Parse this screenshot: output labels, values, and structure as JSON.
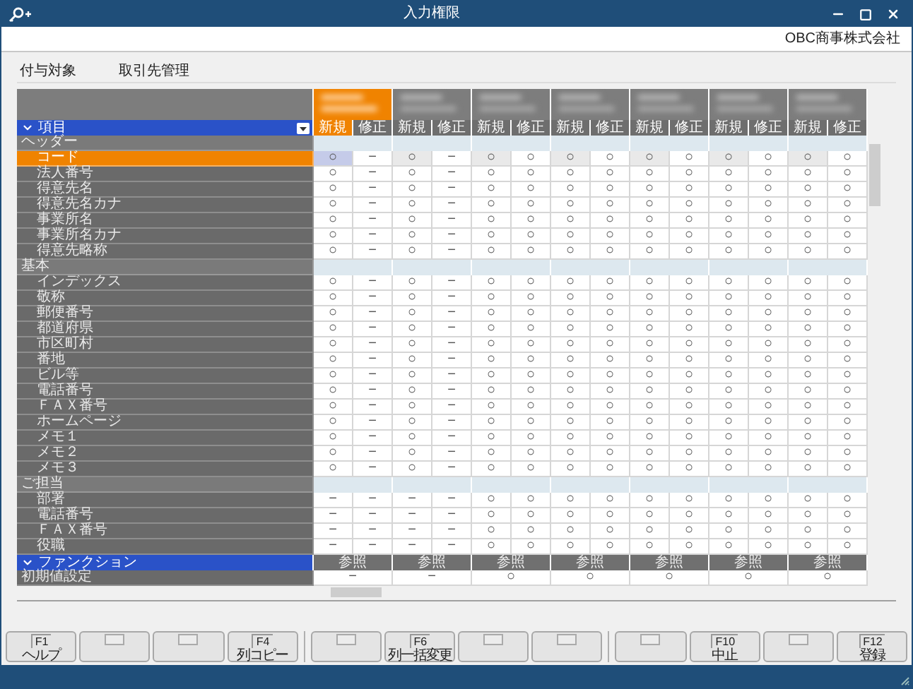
{
  "window": {
    "title": "入力権限"
  },
  "company": "OBC商事株式会社",
  "target": {
    "label": "付与対象",
    "value": "取引先管理"
  },
  "columns": [
    {
      "selected": true,
      "subheaders": [
        "新規",
        "修正"
      ]
    },
    {
      "selected": false,
      "subheaders": [
        "新規",
        "修正"
      ]
    },
    {
      "selected": false,
      "subheaders": [
        "新規",
        "修正"
      ]
    },
    {
      "selected": false,
      "subheaders": [
        "新規",
        "修正"
      ]
    },
    {
      "selected": false,
      "subheaders": [
        "新規",
        "修正"
      ]
    },
    {
      "selected": false,
      "subheaders": [
        "新規",
        "修正"
      ]
    },
    {
      "selected": false,
      "subheaders": [
        "新規",
        "修正"
      ]
    }
  ],
  "items_header": "項目",
  "sections": [
    {
      "label": "ヘッダー",
      "items": [
        {
          "label": "コード",
          "selected": true,
          "values": [
            "○",
            "−",
            "○",
            "−",
            "○",
            "○",
            "○",
            "○",
            "○",
            "○",
            "○",
            "○",
            "○",
            "○"
          ]
        },
        {
          "label": "法人番号",
          "selected": false,
          "values": [
            "○",
            "−",
            "○",
            "−",
            "○",
            "○",
            "○",
            "○",
            "○",
            "○",
            "○",
            "○",
            "○",
            "○"
          ]
        },
        {
          "label": "得意先名",
          "selected": false,
          "values": [
            "○",
            "−",
            "○",
            "−",
            "○",
            "○",
            "○",
            "○",
            "○",
            "○",
            "○",
            "○",
            "○",
            "○"
          ]
        },
        {
          "label": "得意先名カナ",
          "selected": false,
          "values": [
            "○",
            "−",
            "○",
            "−",
            "○",
            "○",
            "○",
            "○",
            "○",
            "○",
            "○",
            "○",
            "○",
            "○"
          ]
        },
        {
          "label": "事業所名",
          "selected": false,
          "values": [
            "○",
            "−",
            "○",
            "−",
            "○",
            "○",
            "○",
            "○",
            "○",
            "○",
            "○",
            "○",
            "○",
            "○"
          ]
        },
        {
          "label": "事業所名カナ",
          "selected": false,
          "values": [
            "○",
            "−",
            "○",
            "−",
            "○",
            "○",
            "○",
            "○",
            "○",
            "○",
            "○",
            "○",
            "○",
            "○"
          ]
        },
        {
          "label": "得意先略称",
          "selected": false,
          "values": [
            "○",
            "−",
            "○",
            "−",
            "○",
            "○",
            "○",
            "○",
            "○",
            "○",
            "○",
            "○",
            "○",
            "○"
          ]
        }
      ]
    },
    {
      "label": "基本",
      "items": [
        {
          "label": "インデックス",
          "selected": false,
          "values": [
            "○",
            "−",
            "○",
            "−",
            "○",
            "○",
            "○",
            "○",
            "○",
            "○",
            "○",
            "○",
            "○",
            "○"
          ]
        },
        {
          "label": "敬称",
          "selected": false,
          "values": [
            "○",
            "−",
            "○",
            "−",
            "○",
            "○",
            "○",
            "○",
            "○",
            "○",
            "○",
            "○",
            "○",
            "○"
          ]
        },
        {
          "label": "郵便番号",
          "selected": false,
          "values": [
            "○",
            "−",
            "○",
            "−",
            "○",
            "○",
            "○",
            "○",
            "○",
            "○",
            "○",
            "○",
            "○",
            "○"
          ]
        },
        {
          "label": "都道府県",
          "selected": false,
          "values": [
            "○",
            "−",
            "○",
            "−",
            "○",
            "○",
            "○",
            "○",
            "○",
            "○",
            "○",
            "○",
            "○",
            "○"
          ]
        },
        {
          "label": "市区町村",
          "selected": false,
          "values": [
            "○",
            "−",
            "○",
            "−",
            "○",
            "○",
            "○",
            "○",
            "○",
            "○",
            "○",
            "○",
            "○",
            "○"
          ]
        },
        {
          "label": "番地",
          "selected": false,
          "values": [
            "○",
            "−",
            "○",
            "−",
            "○",
            "○",
            "○",
            "○",
            "○",
            "○",
            "○",
            "○",
            "○",
            "○"
          ]
        },
        {
          "label": "ビル等",
          "selected": false,
          "values": [
            "○",
            "−",
            "○",
            "−",
            "○",
            "○",
            "○",
            "○",
            "○",
            "○",
            "○",
            "○",
            "○",
            "○"
          ]
        },
        {
          "label": "電話番号",
          "selected": false,
          "values": [
            "○",
            "−",
            "○",
            "−",
            "○",
            "○",
            "○",
            "○",
            "○",
            "○",
            "○",
            "○",
            "○",
            "○"
          ]
        },
        {
          "label": "ＦＡＸ番号",
          "selected": false,
          "values": [
            "○",
            "−",
            "○",
            "−",
            "○",
            "○",
            "○",
            "○",
            "○",
            "○",
            "○",
            "○",
            "○",
            "○"
          ]
        },
        {
          "label": "ホームページ",
          "selected": false,
          "values": [
            "○",
            "−",
            "○",
            "−",
            "○",
            "○",
            "○",
            "○",
            "○",
            "○",
            "○",
            "○",
            "○",
            "○"
          ]
        },
        {
          "label": "メモ１",
          "selected": false,
          "values": [
            "○",
            "−",
            "○",
            "−",
            "○",
            "○",
            "○",
            "○",
            "○",
            "○",
            "○",
            "○",
            "○",
            "○"
          ]
        },
        {
          "label": "メモ２",
          "selected": false,
          "values": [
            "○",
            "−",
            "○",
            "−",
            "○",
            "○",
            "○",
            "○",
            "○",
            "○",
            "○",
            "○",
            "○",
            "○"
          ]
        },
        {
          "label": "メモ３",
          "selected": false,
          "values": [
            "○",
            "−",
            "○",
            "−",
            "○",
            "○",
            "○",
            "○",
            "○",
            "○",
            "○",
            "○",
            "○",
            "○"
          ]
        }
      ]
    },
    {
      "label": "ご担当",
      "items": [
        {
          "label": "部署",
          "selected": false,
          "values": [
            "−",
            "−",
            "−",
            "−",
            "○",
            "○",
            "○",
            "○",
            "○",
            "○",
            "○",
            "○",
            "○",
            "○"
          ]
        },
        {
          "label": "電話番号",
          "selected": false,
          "values": [
            "−",
            "−",
            "−",
            "−",
            "○",
            "○",
            "○",
            "○",
            "○",
            "○",
            "○",
            "○",
            "○",
            "○"
          ]
        },
        {
          "label": "ＦＡＸ番号",
          "selected": false,
          "values": [
            "−",
            "−",
            "−",
            "−",
            "○",
            "○",
            "○",
            "○",
            "○",
            "○",
            "○",
            "○",
            "○",
            "○"
          ]
        },
        {
          "label": "役職",
          "selected": false,
          "values": [
            "−",
            "−",
            "−",
            "−",
            "○",
            "○",
            "○",
            "○",
            "○",
            "○",
            "○",
            "○",
            "○",
            "○"
          ]
        }
      ]
    }
  ],
  "function_section": {
    "label": "ファンクション",
    "cells": [
      "参照",
      "参照",
      "参照",
      "参照",
      "参照",
      "参照",
      "参照"
    ]
  },
  "function_items": [
    {
      "label": "初期値設定",
      "values": [
        "−",
        "−",
        "○",
        "○",
        "○",
        "○",
        "○"
      ]
    }
  ],
  "function_keys": [
    {
      "kind": "key",
      "key": "F1",
      "label": "ヘルプ"
    },
    {
      "kind": "blank"
    },
    {
      "kind": "blank"
    },
    {
      "kind": "key",
      "key": "F4",
      "label": "列コピー"
    },
    {
      "kind": "blank"
    },
    {
      "kind": "key",
      "key": "F6",
      "label": "列一括変更"
    },
    {
      "kind": "blank"
    },
    {
      "kind": "blank"
    },
    {
      "kind": "blank"
    },
    {
      "kind": "key",
      "key": "F10",
      "label": "中止"
    },
    {
      "kind": "blank"
    },
    {
      "kind": "key",
      "key": "F12",
      "label": "登録"
    }
  ]
}
